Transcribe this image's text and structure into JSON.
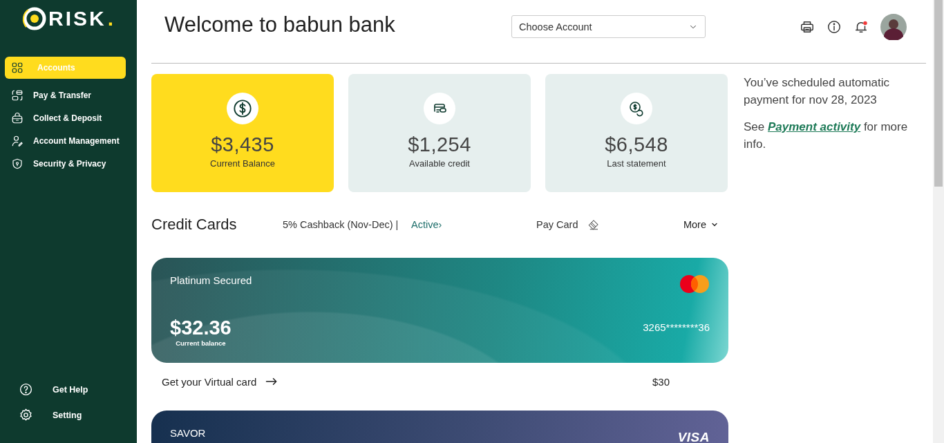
{
  "brand": {
    "name": "RISK",
    "dot": "."
  },
  "sidebar": {
    "items": [
      {
        "label": "Accounts",
        "selected": true
      },
      {
        "label": "Pay & Transfer",
        "selected": false
      },
      {
        "label": "Collect & Deposit",
        "selected": false
      },
      {
        "label": "Account Management",
        "selected": false
      },
      {
        "label": "Security & Privacy",
        "selected": false
      }
    ],
    "footer_items": [
      {
        "label": "Get Help"
      },
      {
        "label": "Setting"
      }
    ]
  },
  "header": {
    "title": "Welcome to babun bank",
    "account_select": {
      "placeholder": "Choose Account"
    },
    "notifications": {
      "unread": true
    }
  },
  "summary_cards": [
    {
      "amount": "$3,435",
      "label": "Current Balance",
      "selected": true
    },
    {
      "amount": "$1,254",
      "label": "Available credit",
      "selected": false
    },
    {
      "amount": "$6,548",
      "label": "Last statement",
      "selected": false
    }
  ],
  "note": {
    "message": "You’ve scheduled automatic payment for nov 28, 2023",
    "prefix": "See",
    "link": "Payment activity",
    "suffix": "for more info."
  },
  "credit_cards_section": {
    "title": "Credit Cards",
    "promo": "5% Cashback (Nov-Dec) |",
    "status_link": "Active›",
    "pay_button": "Pay Card",
    "more_button": "More"
  },
  "cards": [
    {
      "name": "Platinum Secured",
      "kind": "mastercard",
      "balance": "$32.36",
      "balance_label": "Current balance",
      "number": "3265********36"
    },
    {
      "name": "SAVOR",
      "kind": "visa",
      "network_label": "VISA"
    }
  ],
  "virtual_card": {
    "label": "Get your Virtual card",
    "amount": "$30"
  }
}
